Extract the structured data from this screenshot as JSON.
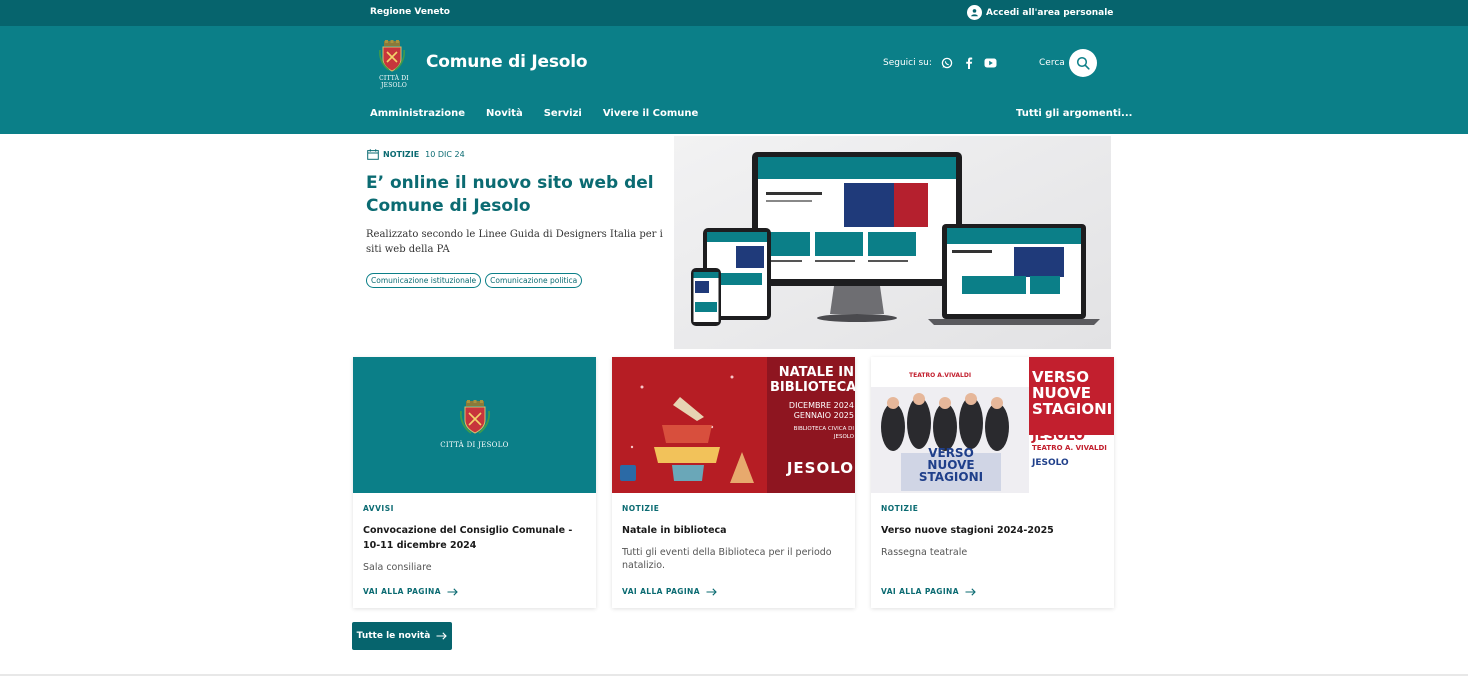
{
  "colors": {
    "primary": "#0b7f88",
    "primary_dark": "#06646d"
  },
  "topbar": {
    "region": "Regione Veneto",
    "login_label": "Accedi all'area personale"
  },
  "header": {
    "logo_caption": "CITTÀ DI JESOLO",
    "site_title": "Comune di Jesolo",
    "social_label": "Seguici su:",
    "social_icons": [
      "whatsapp-icon",
      "facebook-icon",
      "youtube-icon"
    ],
    "search_label": "Cerca",
    "nav": [
      "Amministrazione",
      "Novità",
      "Servizi",
      "Vivere il Comune"
    ],
    "nav_right": "Tutti gli argomenti..."
  },
  "hero": {
    "category": "NOTIZIE",
    "date": "10 DIC 24",
    "title": "E’ online il nuovo sito web del Comune di Jesolo",
    "description": "Realizzato secondo le Linee Guida di Designers Italia per i siti web della PA",
    "tags": [
      "Comunicazione istituzionale",
      "Comunicazione politica"
    ]
  },
  "cards": [
    {
      "category": "AVVISI",
      "title": "Convocazione del Consiglio Comunale - 10-11 dicembre 2024",
      "description": "Sala consiliare",
      "link": "VAI ALLA PAGINA",
      "image_caption": "CITTÀ DI JESOLO"
    },
    {
      "category": "NOTIZIE",
      "title": "Natale in biblioteca",
      "description": "Tutti gli eventi della Biblioteca per il periodo natalizio.",
      "link": "VAI ALLA PAGINA",
      "image_lines": [
        "NATALE IN",
        "BIBLIOTECA",
        "DICEMBRE 2024",
        "GENNAIO 2025",
        "BIBLIOTECA CIVICA DI",
        "JESOLO",
        "JESOLO"
      ]
    },
    {
      "category": "NOTIZIE",
      "title": "Verso nuove stagioni 2024-2025",
      "description": "Rassegna teatrale",
      "link": "VAI ALLA PAGINA",
      "image_lines": [
        "VERSO",
        "NUOVE",
        "STAGIONI",
        "JESOLO",
        "TEATRO A. VIVALDI",
        "VERSO",
        "NUOVE",
        "STAGIONI",
        "JESOLO",
        "TEATRO A.VIVALDI"
      ]
    }
  ],
  "all_news_label": "Tutte le novità"
}
